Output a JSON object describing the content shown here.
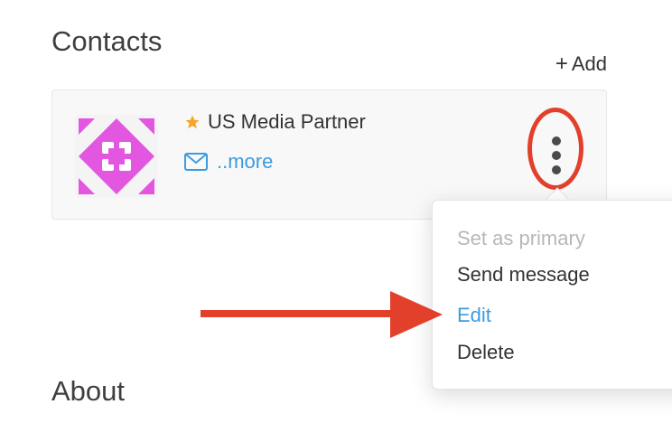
{
  "sections": {
    "contacts_title": "Contacts",
    "about_title": "About"
  },
  "actions": {
    "add_icon": "+",
    "add_label": "Add"
  },
  "contact": {
    "name": "US Media Partner",
    "more_link": "..more",
    "primary_icon": "star-icon",
    "email_icon": "envelope-icon"
  },
  "menu": {
    "items": [
      {
        "label": "Set as primary",
        "state": "disabled"
      },
      {
        "label": "Send message",
        "state": "normal"
      },
      {
        "label": "Edit",
        "state": "highlighted"
      },
      {
        "label": "Delete",
        "state": "normal"
      }
    ]
  },
  "colors": {
    "accent_link": "#3d9be0",
    "star": "#f5a623",
    "annotation_red": "#e2402a",
    "avatar_identicon": "#e256e0"
  }
}
